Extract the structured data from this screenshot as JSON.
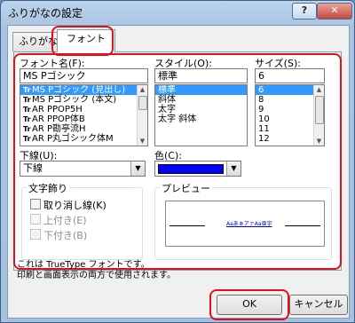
{
  "window": {
    "title": "ふりがなの設定",
    "help_label": "?",
    "close_label": "✕"
  },
  "tabs": [
    {
      "label": "ふりがな"
    },
    {
      "label": "フォント"
    }
  ],
  "font_name": {
    "label": "フォント名(F):",
    "value": "MS Pゴシック",
    "items": [
      {
        "icon": "Tr",
        "label": "MS Pゴシック (見出し)"
      },
      {
        "icon": "Tr",
        "label": "MS Pゴシック (本文)"
      },
      {
        "icon": "Tr",
        "label": "AR PPOP5H"
      },
      {
        "icon": "Tr",
        "label": "AR PPOP体B"
      },
      {
        "icon": "Tr",
        "label": "AR P勘亭流H"
      },
      {
        "icon": "Tr",
        "label": "AR P丸ゴシック体M"
      }
    ]
  },
  "style": {
    "label": "スタイル(O):",
    "value": "標準",
    "items": [
      "標準",
      "斜体",
      "太字",
      "太字 斜体"
    ]
  },
  "size": {
    "label": "サイズ(S):",
    "value": "6",
    "items": [
      "6",
      "8",
      "9",
      "10",
      "11",
      "12"
    ]
  },
  "underline": {
    "label": "下線(U):",
    "value": "下線"
  },
  "color": {
    "label": "色(C):",
    "swatch": "#0000ff"
  },
  "effects": {
    "title": "文字飾り",
    "strikethrough": "取り消し線(K)",
    "superscript": "上付き(E)",
    "subscript": "下付き(B)"
  },
  "preview": {
    "title": "プレビュー",
    "sample": "AaあぁアァAa亜宇"
  },
  "description": {
    "line1": "これは TrueType フォントです。",
    "line2": "印刷と画面表示の両方で使用されます。"
  },
  "buttons": {
    "ok": "OK",
    "cancel": "キャンセル"
  },
  "colors": {
    "selection": "#3399ff",
    "highlight": "#e0101c"
  }
}
